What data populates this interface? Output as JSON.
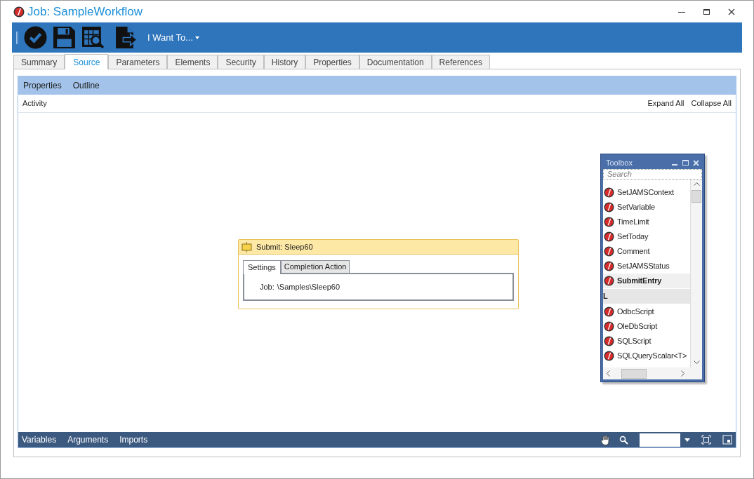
{
  "window": {
    "title": "Job: SampleWorkflow"
  },
  "toolbar": {
    "menu": "I Want To..."
  },
  "tabs": [
    {
      "label": "Summary",
      "selected": false
    },
    {
      "label": "Source",
      "selected": true
    },
    {
      "label": "Parameters",
      "selected": false
    },
    {
      "label": "Elements",
      "selected": false
    },
    {
      "label": "Security",
      "selected": false
    },
    {
      "label": "History",
      "selected": false
    },
    {
      "label": "Properties",
      "selected": false
    },
    {
      "label": "Documentation",
      "selected": false
    },
    {
      "label": "References",
      "selected": false
    }
  ],
  "designer_menu": [
    "Properties",
    "Outline"
  ],
  "breadcrumb": "Activity",
  "actions": [
    "Expand All",
    "Collapse All"
  ],
  "activity": {
    "title": "Submit: Sleep60",
    "tabs": [
      {
        "label": "Settings",
        "selected": true
      },
      {
        "label": "Completion Action",
        "selected": false
      }
    ],
    "label": "Job:",
    "value": "\\Samples\\Sleep60"
  },
  "toolbox": {
    "title": "Toolbox",
    "search": {
      "placeholder": "Search"
    },
    "items": [
      {
        "kind": "item",
        "label": "SetJAMSContext",
        "selected": false
      },
      {
        "kind": "item",
        "label": "SetVariable",
        "selected": false
      },
      {
        "kind": "item",
        "label": "TimeLimit",
        "selected": false
      },
      {
        "kind": "item",
        "label": "SetToday",
        "selected": false
      },
      {
        "kind": "item",
        "label": "Comment",
        "selected": false
      },
      {
        "kind": "item",
        "label": "SetJAMSStatus",
        "selected": false
      },
      {
        "kind": "item",
        "label": "SubmitEntry",
        "selected": true
      },
      {
        "kind": "header",
        "label": "L"
      },
      {
        "kind": "item",
        "label": "OdbcScript",
        "selected": false
      },
      {
        "kind": "item",
        "label": "OleDbScript",
        "selected": false
      },
      {
        "kind": "item",
        "label": "SQLScript",
        "selected": false
      },
      {
        "kind": "item",
        "label": "SQLQueryScalar<T>",
        "selected": false
      }
    ]
  },
  "bottom_tabs": [
    "Variables",
    "Arguments",
    "Imports"
  ]
}
